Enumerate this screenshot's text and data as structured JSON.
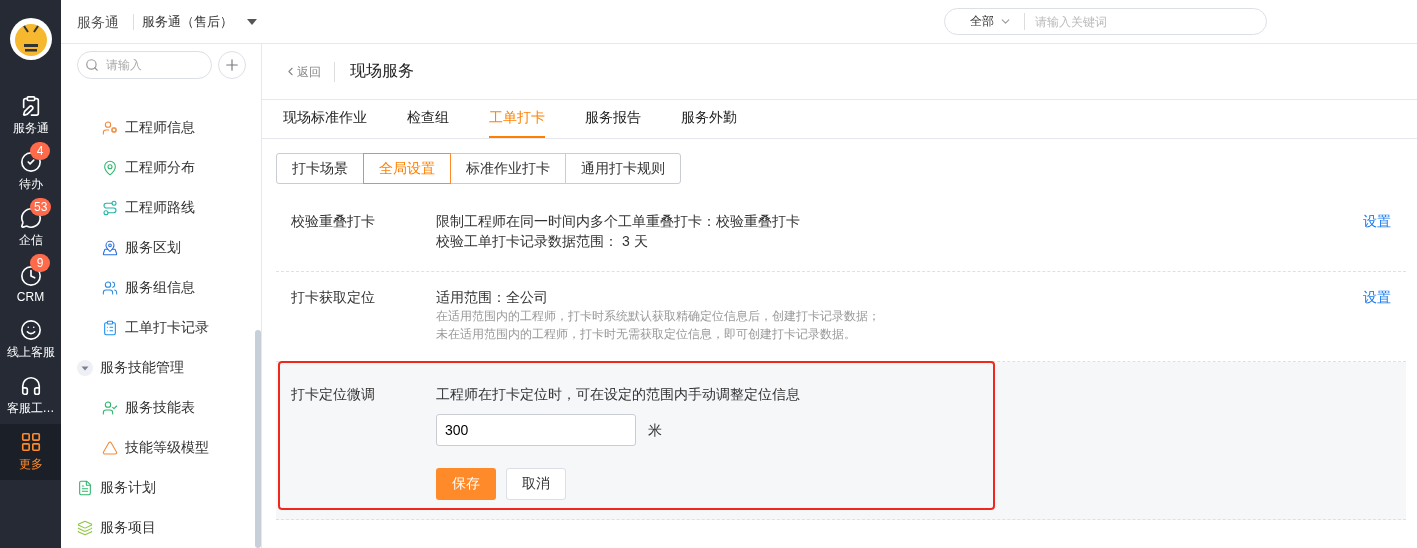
{
  "rail": {
    "items": [
      {
        "label": "服务通",
        "selected": false
      },
      {
        "label": "待办",
        "badge": "4",
        "selected": false
      },
      {
        "label": "企信",
        "badge": "53",
        "selected": false
      },
      {
        "label": "CRM",
        "badge": "9",
        "selected": false
      },
      {
        "label": "线上客服",
        "selected": false
      },
      {
        "label": "客服工…",
        "selected": false
      },
      {
        "label": "更多",
        "selected": true
      }
    ]
  },
  "header": {
    "app": "服务通",
    "switcher": "服务通（售后）",
    "search": {
      "scope": "全部",
      "placeholder": "请输入关键词"
    }
  },
  "sidebar": {
    "search": {
      "placeholder": "请输入"
    },
    "items": [
      {
        "children": [
          {
            "label": "工程师信息"
          },
          {
            "label": "工程师分布"
          },
          {
            "label": "工程师路线"
          },
          {
            "label": "服务区划"
          },
          {
            "label": "服务组信息"
          },
          {
            "label": "工单打卡记录"
          }
        ]
      },
      {
        "label": "服务技能管理",
        "expanded": true,
        "children": [
          {
            "label": "服务技能表"
          },
          {
            "label": "技能等级模型"
          }
        ]
      },
      {
        "label": "服务计划"
      },
      {
        "label": "服务项目"
      }
    ]
  },
  "page": {
    "back": "返回",
    "title": "现场服务",
    "tabs": [
      {
        "label": "现场标准作业",
        "selected": false
      },
      {
        "label": "检查组",
        "selected": false
      },
      {
        "label": "工单打卡",
        "selected": true
      },
      {
        "label": "服务报告",
        "selected": false
      },
      {
        "label": "服务外勤",
        "selected": false
      }
    ],
    "subtabs": [
      {
        "label": "打卡场景",
        "selected": false
      },
      {
        "label": "全局设置",
        "selected": true
      },
      {
        "label": "标准作业打卡",
        "selected": false
      },
      {
        "label": "通用打卡规则",
        "selected": false
      }
    ],
    "settings": [
      {
        "kind": "view",
        "title": "校验重叠打卡",
        "lines": [
          "限制工程师在同一时间内多个工单重叠打卡：校验重叠打卡",
          "校验工单打卡记录数据范围：  3 天"
        ],
        "action": "设置"
      },
      {
        "kind": "view",
        "title": "打卡获取定位",
        "lines": [
          "适用范围：全公司"
        ],
        "notes": [
          "在适用范围内的工程师，打卡时系统默认获取精确定位信息后，创建打卡记录数据；",
          "未在适用范围内的工程师，打卡时无需获取定位信息，即可创建打卡记录数据。"
        ],
        "action": "设置"
      },
      {
        "kind": "edit",
        "title": "打卡定位微调",
        "lines": [
          "工程师在打卡定位时，可在设定的范围内手动调整定位信息"
        ],
        "value": "300",
        "unit": "米",
        "save": "保存",
        "cancel": "取消",
        "highlighted": true
      }
    ]
  }
}
